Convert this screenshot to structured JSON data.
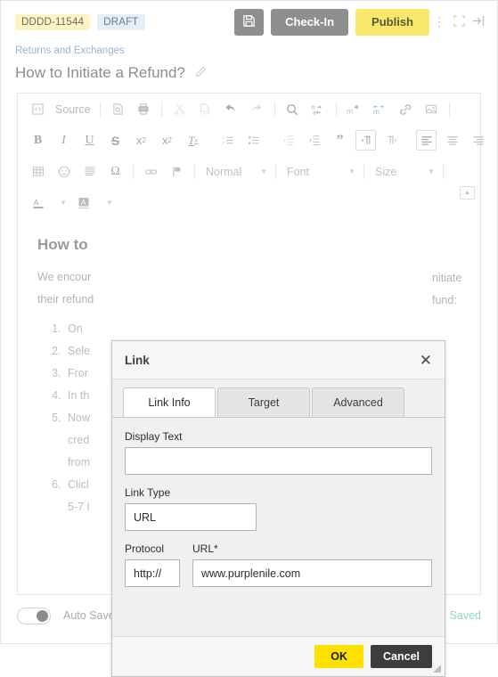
{
  "topbar": {
    "doc_id": "DDDD-11544",
    "status": "DRAFT",
    "save_icon": "floppy-disk-icon",
    "checkin_label": "Check-In",
    "publish_label": "Publish",
    "kebab_icon": "kebab-menu-icon",
    "fullscreen_icon": "fullscreen-icon",
    "collapse_icon": "collapse-right-icon"
  },
  "breadcrumb": "Returns and Exchanges",
  "title": {
    "text": "How to Initiate a Refund?",
    "edit_icon": "pencil-icon"
  },
  "toolbar": {
    "source_label": "Source",
    "row1": [
      "source-icon",
      "preview-icon",
      "print-icon",
      "cut-icon",
      "copy-icon",
      "undo-icon",
      "redo-icon",
      "find-icon",
      "replace-icon",
      "insert-macro-icon",
      "edit-macro-icon",
      "link-icon",
      "image-icon"
    ],
    "row2": [
      "bold-icon",
      "italic-icon",
      "underline-icon",
      "strikethrough-icon",
      "subscript-icon",
      "superscript-icon",
      "remove-format-icon",
      "numbered-list-icon",
      "bulleted-list-icon",
      "outdent-icon",
      "indent-icon",
      "blockquote-icon",
      "ltr-icon",
      "rtl-icon",
      "align-left-icon",
      "align-center-icon",
      "align-right-icon"
    ],
    "row3": [
      "table-icon",
      "smiley-icon",
      "horizontal-rule-icon",
      "special-char-icon",
      "anchor-icon",
      "flag-icon"
    ],
    "row4": [
      "text-color-icon",
      "background-color-icon"
    ],
    "format_select": "Normal",
    "font_select": "Font",
    "size_select": "Size",
    "collapse_toolbar_icon": "collapse-toolbar-icon"
  },
  "document": {
    "heading": "How to",
    "paragraph_line1": "We encour",
    "paragraph_line2": "their refund",
    "paragraph_right1": "nitiate",
    "paragraph_right2": "fund:",
    "steps": [
      "On",
      "Sele",
      "Fror",
      "In th",
      "Now",
      "Clicl"
    ],
    "step5_cont1": "cred",
    "step5_cont2": "from",
    "step6_cont1": "5-7 l"
  },
  "modal": {
    "title": "Link",
    "close_icon": "close-icon",
    "tabs": [
      {
        "label": "Link Info",
        "active": true
      },
      {
        "label": "Target",
        "active": false
      },
      {
        "label": "Advanced",
        "active": false
      }
    ],
    "display_text": {
      "label": "Display Text",
      "value": "",
      "placeholder": ""
    },
    "link_type": {
      "label": "Link Type",
      "value": "URL"
    },
    "protocol": {
      "label": "Protocol",
      "value": "http://"
    },
    "url": {
      "label": "URL*",
      "value": "www.purplenile.com",
      "placeholder": ""
    },
    "ok_label": "OK",
    "cancel_label": "Cancel",
    "resize_grip": "resize-grip-icon"
  },
  "footer": {
    "autosave_label": "Auto Save",
    "autosave_on": true,
    "status": "Saved"
  },
  "colors": {
    "publish_yellow": "#f8e86b",
    "ok_yellow": "#ffe100",
    "cancel_dark": "#3d3d3d",
    "gray_button": "#8f8f8f",
    "badge_id_bg": "#fdf3c4",
    "badge_state_bg": "#e4eef7",
    "saved_green": "#8fd6bb"
  }
}
